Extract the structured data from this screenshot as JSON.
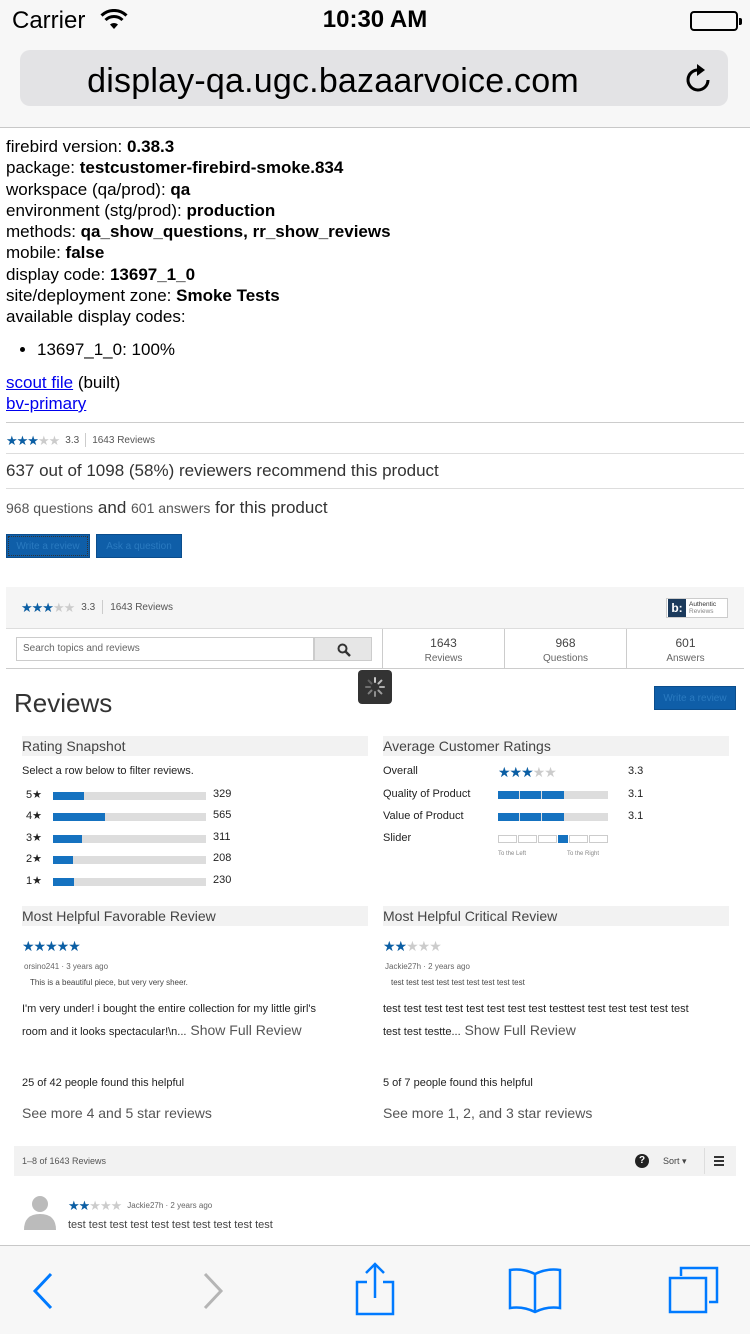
{
  "status_bar": {
    "carrier": "Carrier",
    "time": "10:30 AM"
  },
  "browser": {
    "url": "display-qa.ugc.bazaarvoice.com"
  },
  "debug": {
    "lines": [
      {
        "label": "firebird version: ",
        "value": "0.38.3"
      },
      {
        "label": "package: ",
        "value": "testcustomer-firebird-smoke.834"
      },
      {
        "label": "workspace (qa/prod): ",
        "value": "qa"
      },
      {
        "label": "environment (stg/prod): ",
        "value": "production"
      },
      {
        "label": "methods: ",
        "value": "qa_show_questions, rr_show_reviews"
      },
      {
        "label": "mobile: ",
        "value": "false"
      },
      {
        "label": "display code: ",
        "value": "13697_1_0"
      },
      {
        "label": "site/deployment zone: ",
        "value": "Smoke Tests"
      }
    ],
    "available_label": "available display codes:",
    "available_codes": [
      "13697_1_0: 100%"
    ],
    "scout_link": "scout file",
    "scout_suffix": " (built)",
    "primary_link": "bv-primary"
  },
  "summary": {
    "rating": 3.3,
    "rating_text": "3.3",
    "reviews_text": "1643 Reviews",
    "recommend": "637 out of 1098 (58%) reviewers recommend this product",
    "questions_count": "968 questions",
    "and_word": " and ",
    "answers_count": "601 answers",
    "qa_suffix": " for this product",
    "write_review_label": "Write a review",
    "ask_question_label": "Ask a question"
  },
  "widget": {
    "badge_top": "Authentic",
    "badge_bottom": "Reviews",
    "badge_letter": "b:",
    "search_placeholder": "Search topics and reviews",
    "stats": [
      {
        "number": "1643",
        "label": "Reviews"
      },
      {
        "number": "968",
        "label": "Questions"
      },
      {
        "number": "601",
        "label": "Answers"
      }
    ],
    "reviews_title": "Reviews",
    "write_review_label": "Write a review"
  },
  "rating_snapshot": {
    "title": "Rating Snapshot",
    "subtitle": "Select a row below to filter reviews.",
    "rows": [
      {
        "label": "5★",
        "count": "329",
        "fraction": 0.2
      },
      {
        "label": "4★",
        "count": "565",
        "fraction": 0.34
      },
      {
        "label": "3★",
        "count": "311",
        "fraction": 0.19
      },
      {
        "label": "2★",
        "count": "208",
        "fraction": 0.13
      },
      {
        "label": "1★",
        "count": "230",
        "fraction": 0.14
      }
    ]
  },
  "avg_ratings": {
    "title": "Average Customer Ratings",
    "overall_label": "Overall",
    "overall_value": "3.3",
    "rows": [
      {
        "label": "Quality of Product",
        "value": "3.1",
        "filled": 3.1
      },
      {
        "label": "Value of Product",
        "value": "3.1",
        "filled": 3.1
      }
    ],
    "slider_label": "Slider",
    "slider_left": "To the Left",
    "slider_right": "To the Right",
    "slider_position": 0.55
  },
  "favorable": {
    "title": "Most Helpful Favorable Review",
    "rating": 5,
    "author": "orsino241",
    "date": " · 3 years ago",
    "headline": "This is a beautiful piece, but very very sheer.",
    "body": "I'm very under! i bought the entire collection for my little girl's room and it looks spectacular!\\n...",
    "show_full": " Show Full Review",
    "helpful": "25 of 42 people found this helpful",
    "see_more": "See more 4 and 5 star reviews"
  },
  "critical": {
    "title": "Most Helpful Critical Review",
    "rating": 2,
    "author": "Jackie27h",
    "date": " · 2 years ago",
    "headline": "test test test test test test test test test",
    "body": "test test test test test test test test testtest test test test test test test test testte...",
    "show_full": " Show Full Review",
    "helpful": "5 of 7 people found this helpful",
    "see_more": "See more 1, 2, and 3 star reviews"
  },
  "list": {
    "count_text": "1–8 of 1643 Reviews",
    "help_label": "?",
    "sort_label": "Sort ▾"
  },
  "first_review": {
    "rating": 2,
    "author": "Jackie27h",
    "date": " · 2 years ago",
    "text": "test test test test test test test test test test"
  },
  "colors": {
    "accent": "#0f5ea8",
    "star": "#0b5fa5",
    "ios_tint": "#007aff"
  }
}
